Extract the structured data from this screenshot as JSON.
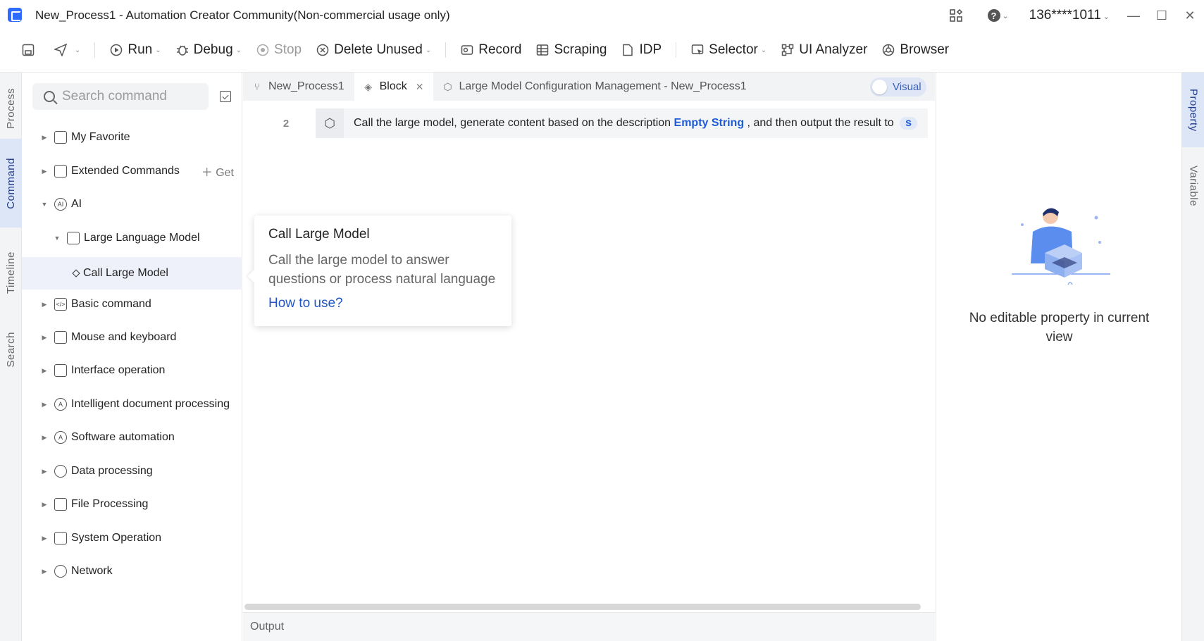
{
  "window": {
    "title": "New_Process1 - Automation Creator Community(Non-commercial usage only)",
    "user": "136****1011"
  },
  "toolbar": {
    "run": "Run",
    "debug": "Debug",
    "stop": "Stop",
    "delete_unused": "Delete Unused",
    "record": "Record",
    "scraping": "Scraping",
    "idp": "IDP",
    "selector": "Selector",
    "ui_analyzer": "UI Analyzer",
    "browser": "Browser"
  },
  "left_rail": {
    "tabs": [
      "Process",
      "Command",
      "Timeline",
      "Search"
    ],
    "active": "Command"
  },
  "command_panel": {
    "search_placeholder": "Search command",
    "get_label": "Get",
    "items": [
      {
        "label": "My Favorite",
        "icon": "folder-icon"
      },
      {
        "label": "Extended Commands",
        "icon": "extension-icon"
      },
      {
        "label": "AI",
        "icon": "ai-icon"
      },
      {
        "label": "Large Language Model",
        "icon": "cube-icon"
      },
      {
        "label": "Call Large Model",
        "icon": "diamond-icon"
      },
      {
        "label": "Basic command",
        "icon": "code-icon"
      },
      {
        "label": "Mouse and keyboard",
        "icon": "keyboard-icon"
      },
      {
        "label": "Interface operation",
        "icon": "window-icon"
      },
      {
        "label": "Intelligent document processing",
        "icon": "document-ai-icon"
      },
      {
        "label": "Software automation",
        "icon": "software-icon"
      },
      {
        "label": "Data processing",
        "icon": "pie-chart-icon"
      },
      {
        "label": "File Processing",
        "icon": "file-icon"
      },
      {
        "label": "System Operation",
        "icon": "monitor-icon"
      },
      {
        "label": "Network",
        "icon": "globe-icon"
      }
    ]
  },
  "editor": {
    "tabs": [
      {
        "label": "New_Process1"
      },
      {
        "label": "Block"
      },
      {
        "label": "Large Model Configuration Management - New_Process1"
      }
    ],
    "visual_label": "Visual",
    "line_number": "2",
    "line_text_1": "Call the large model, generate content based on the description",
    "line_kw": "Empty String",
    "line_text_2": ", and then output the result to",
    "line_pill": "s",
    "output_label": "Output"
  },
  "tooltip": {
    "title": "Call Large Model",
    "description": "Call the large model to answer questions or process natural language",
    "link": "How to use?"
  },
  "property_panel": {
    "empty_text": "No editable property in current view"
  },
  "right_rail": {
    "tabs": [
      "Property",
      "Variable"
    ],
    "active": "Property"
  }
}
